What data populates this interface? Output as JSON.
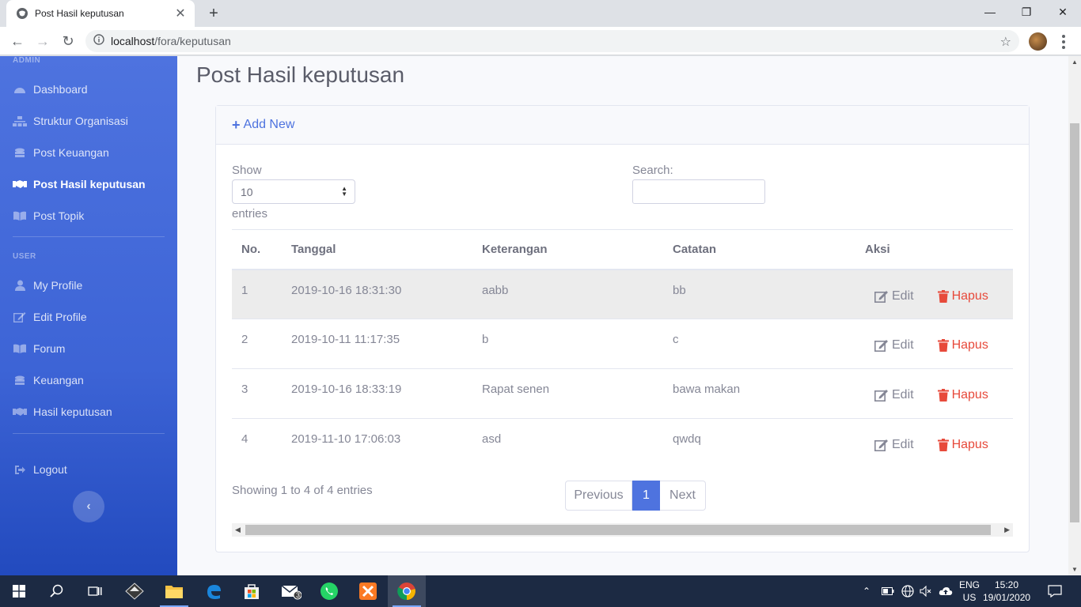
{
  "browser": {
    "tab_title": "Post Hasil keputusan",
    "url_host": "localhost",
    "url_path": "/fora/keputusan"
  },
  "sidebar": {
    "heading_admin": "ADMIN",
    "admin_items": [
      {
        "label": "Dashboard",
        "icon": "tachometer-icon"
      },
      {
        "label": "Struktur Organisasi",
        "icon": "sitemap-icon"
      },
      {
        "label": "Post Keuangan",
        "icon": "coins-icon"
      },
      {
        "label": "Post Hasil keputusan",
        "icon": "handshake-icon",
        "active": true
      },
      {
        "label": "Post Topik",
        "icon": "book-icon"
      }
    ],
    "heading_user": "USER",
    "user_items": [
      {
        "label": "My Profile",
        "icon": "user-icon"
      },
      {
        "label": "Edit Profile",
        "icon": "edit-icon"
      },
      {
        "label": "Forum",
        "icon": "book-icon"
      },
      {
        "label": "Keuangan",
        "icon": "coins-icon"
      },
      {
        "label": "Hasil keputusan",
        "icon": "handshake-icon"
      }
    ],
    "logout": "Logout"
  },
  "page": {
    "title": "Post Hasil keputusan",
    "add_new": "Add New",
    "show_label": "Show",
    "entries_label": "entries",
    "length_value": "10",
    "search_label": "Search:",
    "search_value": ""
  },
  "table": {
    "headers": [
      "No.",
      "Tanggal",
      "Keterangan",
      "Catatan",
      "Aksi"
    ],
    "rows": [
      {
        "no": "1",
        "tanggal": "2019-10-16 18:31:30",
        "keterangan": "aabb",
        "catatan": "bb"
      },
      {
        "no": "2",
        "tanggal": "2019-10-11 11:17:35",
        "keterangan": "b",
        "catatan": "c"
      },
      {
        "no": "3",
        "tanggal": "2019-10-16 18:33:19",
        "keterangan": "Rapat senen",
        "catatan": "bawa makan"
      },
      {
        "no": "4",
        "tanggal": "2019-11-10 17:06:03",
        "keterangan": "asd",
        "catatan": "qwdq"
      }
    ],
    "edit_label": "Edit",
    "delete_label": "Hapus"
  },
  "footer": {
    "info": "Showing 1 to 4 of 4 entries",
    "previous": "Previous",
    "current_page": "1",
    "next": "Next"
  },
  "taskbar": {
    "lang_line1": "ENG",
    "lang_line2": "US",
    "time": "15:20",
    "date": "19/01/2020",
    "mail_badge": "3"
  },
  "colors": {
    "primary": "#4e73df",
    "danger": "#e74a3b",
    "text_muted": "#858796"
  }
}
